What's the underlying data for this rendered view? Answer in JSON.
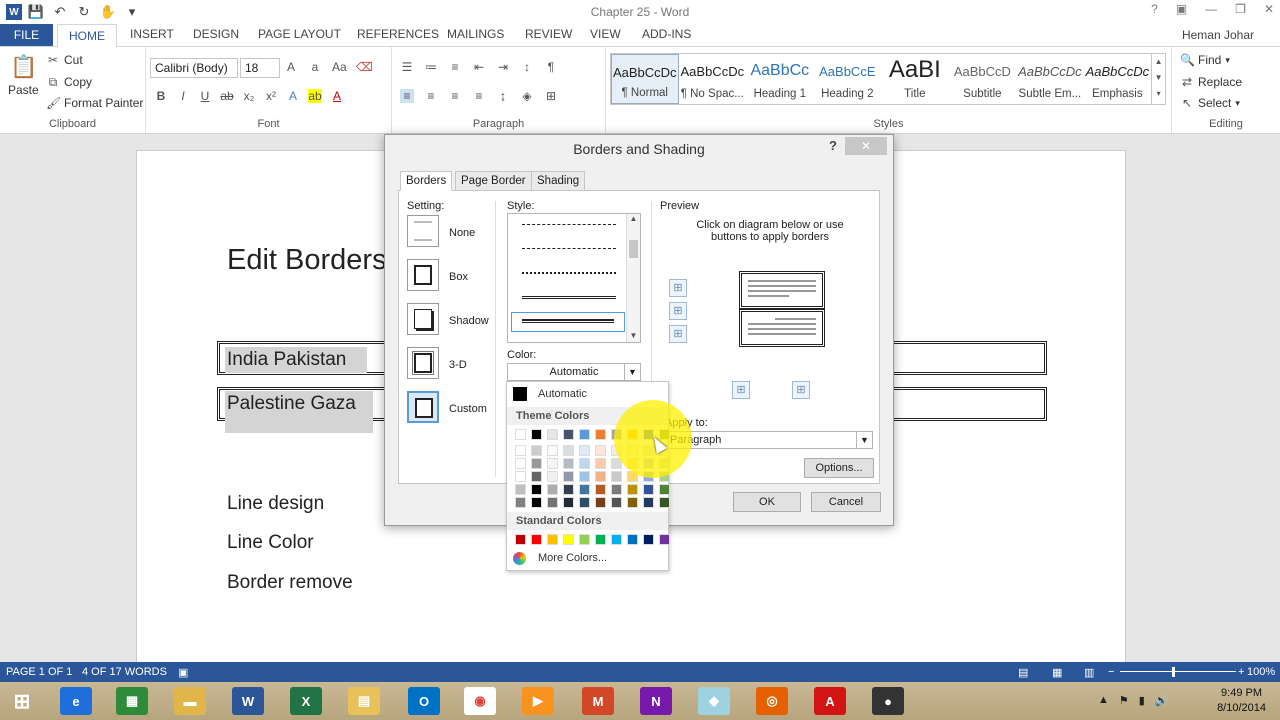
{
  "window": {
    "title": "Chapter 25 - Word",
    "user": "Heman Johar"
  },
  "tabs": [
    "FILE",
    "HOME",
    "INSERT",
    "DESIGN",
    "PAGE LAYOUT",
    "REFERENCES",
    "MAILINGS",
    "REVIEW",
    "VIEW",
    "ADD-INS"
  ],
  "ribbon": {
    "clipboard": {
      "paste": "Paste",
      "cut": "Cut",
      "copy": "Copy",
      "format_painter": "Format Painter",
      "label": "Clipboard"
    },
    "font": {
      "name": "Calibri (Body)",
      "size": "18",
      "label": "Font"
    },
    "paragraph": {
      "label": "Paragraph"
    },
    "styles": {
      "label": "Styles",
      "items": [
        {
          "preview": "AaBbCcDc",
          "name": "¶ Normal"
        },
        {
          "preview": "AaBbCcDc",
          "name": "¶ No Spac..."
        },
        {
          "preview": "AaBbCc",
          "name": "Heading 1"
        },
        {
          "preview": "AaBbCcE",
          "name": "Heading 2"
        },
        {
          "preview": "AaBI",
          "name": "Title"
        },
        {
          "preview": "AaBbCcD",
          "name": "Subtitle"
        },
        {
          "preview": "AaBbCcDc",
          "name": "Subtle Em..."
        },
        {
          "preview": "AaBbCcDc",
          "name": "Emphasis"
        }
      ]
    },
    "editing": {
      "find": "Find",
      "replace": "Replace",
      "select": "Select",
      "label": "Editing"
    }
  },
  "document": {
    "heading": "Edit Borders",
    "para1": "India Pakistan",
    "para2": "Palestine Gaza",
    "line1": "Line design",
    "line2": "Line Color",
    "line3": "Border remove"
  },
  "dialog": {
    "title": "Borders and Shading",
    "help": "?",
    "tabs": [
      "Borders",
      "Page Border",
      "Shading"
    ],
    "setting_label": "Setting:",
    "settings": [
      "None",
      "Box",
      "Shadow",
      "3-D",
      "Custom"
    ],
    "style_label": "Style:",
    "color_label": "Color:",
    "color_value": "Automatic",
    "preview_label": "Preview",
    "preview_hint": "Click on diagram below or use buttons to apply borders",
    "apply_label": "Apply to:",
    "apply_value": "Paragraph",
    "options": "Options...",
    "ok": "OK",
    "cancel": "Cancel"
  },
  "color_dropdown": {
    "automatic": "Automatic",
    "theme_header": "Theme Colors",
    "standard_header": "Standard Colors",
    "more": "More Colors...",
    "theme_top": [
      "#ffffff",
      "#000000",
      "#e7e6e6",
      "#44546a",
      "#5b9bd5",
      "#ed7d31",
      "#a5a5a5",
      "#ffc000",
      "#4472c4",
      "#70ad47"
    ],
    "standard": [
      "#c00000",
      "#ff0000",
      "#ffc000",
      "#ffff00",
      "#92d050",
      "#00b050",
      "#00b0f0",
      "#0070c0",
      "#002060",
      "#7030a0"
    ]
  },
  "statusbar": {
    "page": "PAGE 1 OF 1",
    "words": "4 OF 17 WORDS",
    "zoom": "100%"
  },
  "taskbar": {
    "time": "9:49 PM",
    "date": "8/10/2014"
  },
  "colors": {
    "accent": "#2b579a"
  }
}
